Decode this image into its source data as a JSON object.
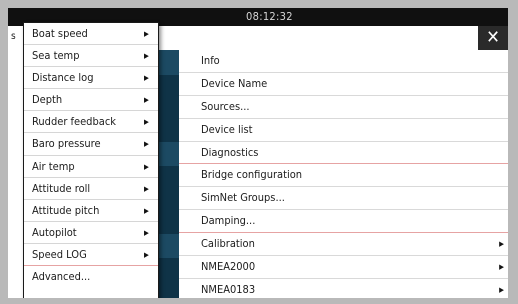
{
  "status_bar": {
    "time": "08:12:32"
  },
  "header": {
    "title_fragment": "s",
    "close_glyph": "✕"
  },
  "submenu": {
    "items": [
      {
        "label": "Boat speed",
        "has_submenu": true
      },
      {
        "label": "Sea temp",
        "has_submenu": true
      },
      {
        "label": "Distance log",
        "has_submenu": true
      },
      {
        "label": "Depth",
        "has_submenu": true
      },
      {
        "label": "Rudder feedback",
        "has_submenu": true
      },
      {
        "label": "Baro pressure",
        "has_submenu": true
      },
      {
        "label": "Air temp",
        "has_submenu": true
      },
      {
        "label": "Attitude roll",
        "has_submenu": true
      },
      {
        "label": "Attitude pitch",
        "has_submenu": true
      },
      {
        "label": "Autopilot",
        "has_submenu": true
      },
      {
        "label": "Speed LOG",
        "has_submenu": true
      },
      {
        "label": "Advanced...",
        "has_submenu": false
      }
    ]
  },
  "device_menu": {
    "items": [
      {
        "label": "Info"
      },
      {
        "label": "Device Name"
      },
      {
        "label": "Sources..."
      },
      {
        "label": "Device list"
      },
      {
        "label": "Diagnostics"
      },
      {
        "label": "Bridge configuration"
      },
      {
        "label": "SimNet Groups..."
      },
      {
        "label": "Damping..."
      },
      {
        "label": "Calibration",
        "has_submenu": true
      },
      {
        "label": "NMEA2000",
        "has_submenu": true
      },
      {
        "label": "NMEA0183",
        "has_submenu": true
      }
    ]
  },
  "glyphs": {
    "submenu_arrow": "▶"
  },
  "colors": {
    "background": "#b9b9b9",
    "panel": "#ffffff",
    "dark_bar": "#101010",
    "separator_accent": "#e6a3a3",
    "side_strip": "#0f3347"
  }
}
